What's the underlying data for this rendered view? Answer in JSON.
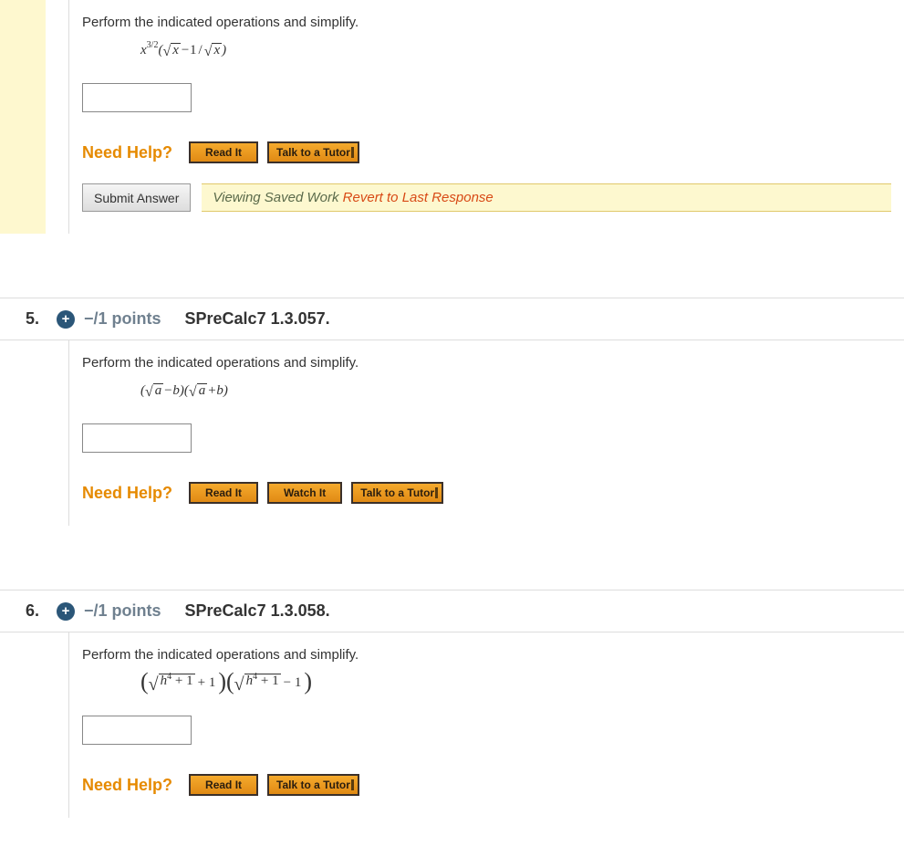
{
  "q4": {
    "instr": "Perform the indicated operations and simplify.",
    "math": {
      "base": "x",
      "exp_tex": "3/2",
      "lp": "(",
      "sqrt_tick": "√",
      "sqrt_arg1": "x",
      "minus": " − ",
      "one": "1",
      "slash": "/",
      "sqrt_arg2": "x",
      "rp": ")"
    },
    "need_help": "Need Help?",
    "read": "Read It",
    "tutor": "Talk to a Tutor",
    "submit": "Submit Answer",
    "saved_prefix": "Viewing Saved Work ",
    "revert": "Revert to Last Response"
  },
  "q5": {
    "num": "5.",
    "plus": "+",
    "points": "−/1 points",
    "src": "SPreCalc7 1.3.057.",
    "instr": "Perform the indicated operations and simplify.",
    "math": {
      "lp1": "(",
      "sqrt_tick": "√",
      "arg_a1": "a",
      "minus": " − ",
      "b1": "b",
      "rp1": ")(",
      "arg_a2": "a",
      "plus": " + ",
      "b2": "b",
      "rp2": ")"
    },
    "need_help": "Need Help?",
    "read": "Read It",
    "watch": "Watch It",
    "tutor": "Talk to a Tutor"
  },
  "q6": {
    "num": "6.",
    "plus": "+",
    "points": "−/1 points",
    "src": "SPreCalc7 1.3.058.",
    "instr": "Perform the indicated operations and simplify.",
    "math": {
      "lp1": "(",
      "sqrt_tick": "√",
      "h": "h",
      "sup4": "4",
      "plus1a": " + 1",
      "plus1b": " + 1",
      "rp_lp": ")(",
      "minus1": " − 1",
      "rp2": ")"
    },
    "need_help": "Need Help?",
    "read": "Read It",
    "tutor": "Talk to a Tutor"
  }
}
